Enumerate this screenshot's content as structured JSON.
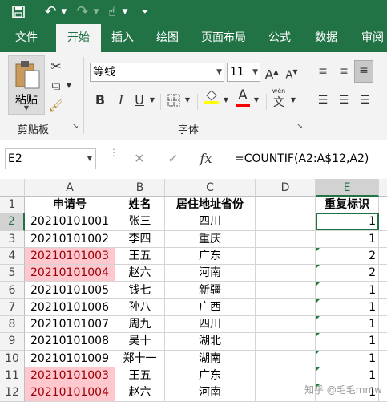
{
  "qat": {
    "save_icon": "save-icon",
    "undo_icon": "undo-icon",
    "redo_icon": "redo-icon",
    "touch_icon": "touch-mode-icon",
    "customize_icon": "customize-icon"
  },
  "tabs": [
    "文件",
    "开始",
    "插入",
    "绘图",
    "页面布局",
    "公式",
    "数据",
    "审阅"
  ],
  "active_tab": "开始",
  "ribbon": {
    "paste_label": "粘贴",
    "clipboard_label": "剪贴板",
    "font_label": "字体",
    "font_name": "等线",
    "font_size": "11",
    "bold": "B",
    "italic": "I",
    "underline": "U",
    "grow_font": "A",
    "shrink_font": "A",
    "font_color_letter": "A",
    "phonetic_char": "文",
    "phonetic_sub": "wén",
    "highlight_color": "#ffff00",
    "font_color": "#ff0000"
  },
  "formula_bar": {
    "name_box": "E2",
    "fx": "fx",
    "formula": "=COUNTIF(A2:A$12,A2)"
  },
  "columns": [
    "A",
    "B",
    "C",
    "D",
    "E"
  ],
  "rows": [
    "1",
    "2",
    "3",
    "4",
    "5",
    "6",
    "7",
    "8",
    "9",
    "10",
    "11",
    "12"
  ],
  "header_row": [
    "申请号",
    "姓名",
    "居住地址省份",
    "",
    "重复标识"
  ],
  "data": [
    {
      "id": "20210101001",
      "name": "张三",
      "province": "四川",
      "flag": "1",
      "dup": false
    },
    {
      "id": "20210101002",
      "name": "李四",
      "province": "重庆",
      "flag": "1",
      "dup": false
    },
    {
      "id": "20210101003",
      "name": "王五",
      "province": "广东",
      "flag": "2",
      "dup": true
    },
    {
      "id": "20210101004",
      "name": "赵六",
      "province": "河南",
      "flag": "2",
      "dup": true
    },
    {
      "id": "20210101005",
      "name": "钱七",
      "province": "新疆",
      "flag": "1",
      "dup": false
    },
    {
      "id": "20210101006",
      "name": "孙八",
      "province": "广西",
      "flag": "1",
      "dup": false
    },
    {
      "id": "20210101007",
      "name": "周九",
      "province": "四川",
      "flag": "1",
      "dup": false
    },
    {
      "id": "20210101008",
      "name": "吴十",
      "province": "湖北",
      "flag": "1",
      "dup": false
    },
    {
      "id": "20210101009",
      "name": "郑十一",
      "province": "湖南",
      "flag": "1",
      "dup": false
    },
    {
      "id": "20210101003",
      "name": "王五",
      "province": "广东",
      "flag": "1",
      "dup": true
    },
    {
      "id": "20210101004",
      "name": "赵六",
      "province": "河南",
      "flag": "1",
      "dup": true
    }
  ],
  "watermark": "知乎 @毛毛mmw"
}
